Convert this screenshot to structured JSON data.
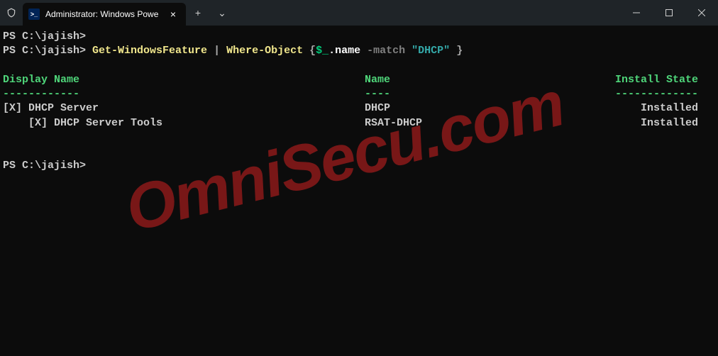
{
  "titlebar": {
    "tab_title": "Administrator: Windows Powe",
    "new_tab": "+",
    "tab_menu": "⌄",
    "close": "×"
  },
  "terminal": {
    "prompt1_path": "PS C:\\jajish>",
    "prompt2_path": "PS C:\\jajish> ",
    "cmd_get": "Get-WindowsFeature",
    "cmd_pipe": " | ",
    "cmd_where": "Where-Object",
    "cmd_brace_open": " {",
    "cmd_var": "$_",
    "cmd_dotname": ".name ",
    "cmd_match": "-match ",
    "cmd_string": "\"DHCP\"",
    "cmd_brace_close": " }",
    "blank": "",
    "header_display": "Display Name",
    "header_name": "Name",
    "header_state": "Install State",
    "sep_display": "------------",
    "sep_name": "----",
    "sep_state": "-------------",
    "row1_display": "[X] DHCP Server",
    "row1_name": "DHCP",
    "row1_state": "Installed",
    "row2_display": "    [X] DHCP Server Tools",
    "row2_name": "RSAT-DHCP",
    "row2_state": "Installed",
    "prompt3_path": "PS C:\\jajish>"
  },
  "watermark": "OmniSecu.com"
}
